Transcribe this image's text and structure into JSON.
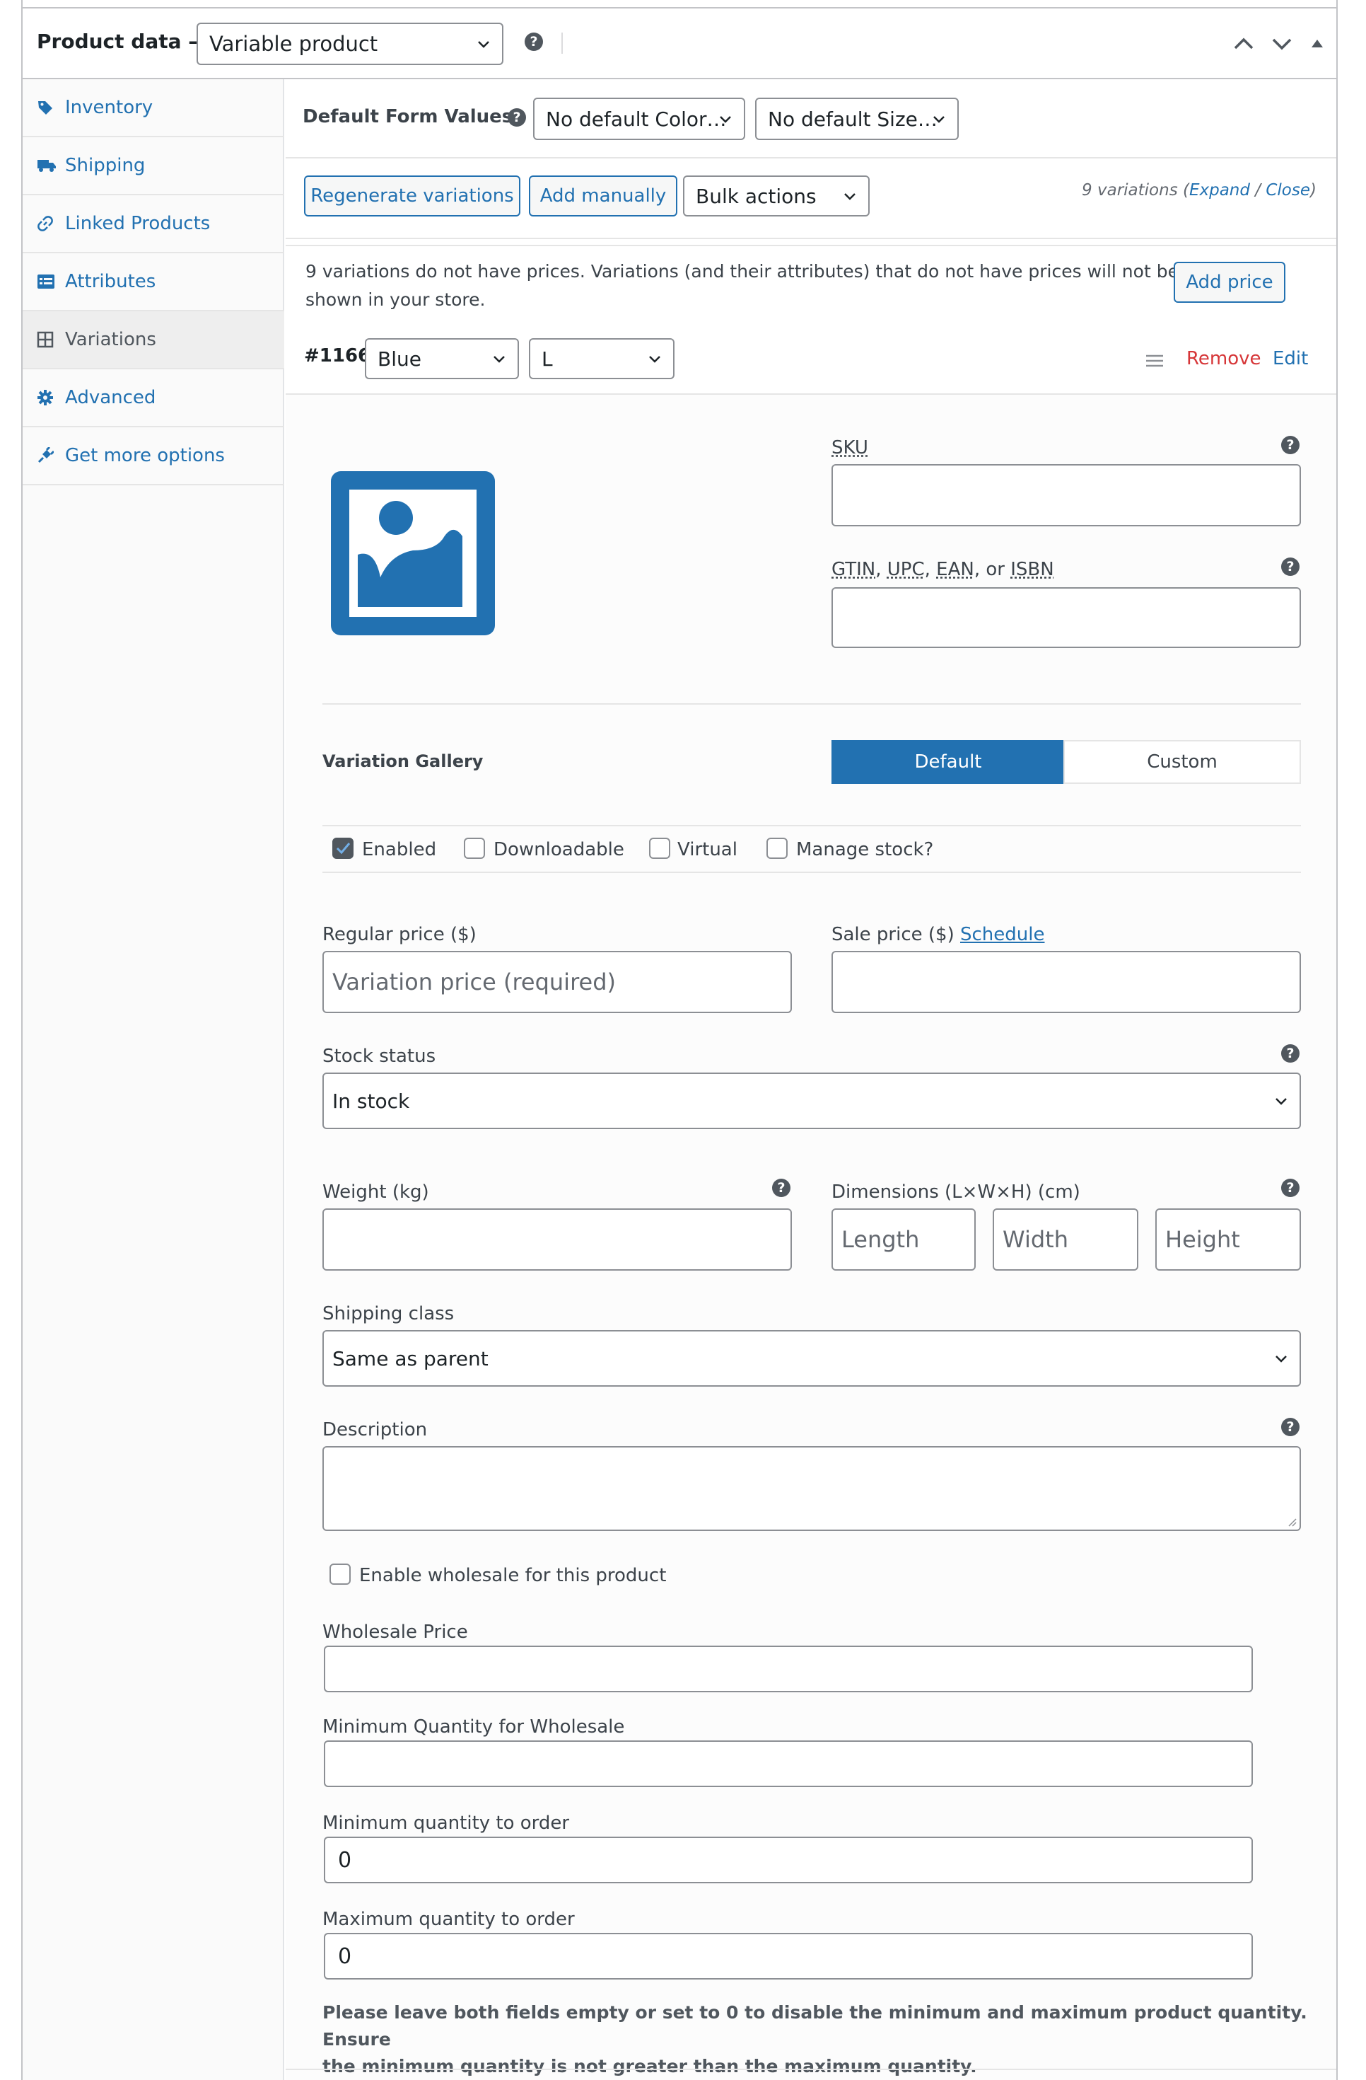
{
  "header": {
    "title": "Product data —",
    "product_type": "Variable product"
  },
  "sidebar": {
    "items": [
      {
        "label": "Inventory",
        "icon": "tag-icon"
      },
      {
        "label": "Shipping",
        "icon": "truck-icon"
      },
      {
        "label": "Linked Products",
        "icon": "link-icon"
      },
      {
        "label": "Attributes",
        "icon": "list-icon"
      },
      {
        "label": "Variations",
        "icon": "grid-icon"
      },
      {
        "label": "Advanced",
        "icon": "gear-icon"
      },
      {
        "label": "Get more options",
        "icon": "plugin-icon"
      }
    ]
  },
  "defaults": {
    "label": "Default Form Values:",
    "color": "No default Color…",
    "size": "No default Size…"
  },
  "toolbar": {
    "regenerate": "Regenerate variations",
    "add_manually": "Add manually",
    "bulk_actions": "Bulk actions",
    "count": "9 variations (",
    "expand": "Expand",
    "slash": " / ",
    "close": "Close",
    "close_paren": ")"
  },
  "notice": {
    "line1": "9 variations do not have prices. Variations (and their attributes) that do not have prices will not be",
    "line2": "shown in your store.",
    "add_price": "Add price"
  },
  "variation": {
    "id": "#1166",
    "color": "Blue",
    "size": "L",
    "remove": "Remove",
    "edit": "Edit",
    "sku_label": "SKU",
    "gtin_label_parts": [
      "GTIN",
      ", ",
      "UPC",
      ", ",
      "EAN",
      ", or ",
      "ISBN"
    ],
    "gallery_label": "Variation Gallery",
    "gallery_default": "Default",
    "gallery_custom": "Custom",
    "enabled": "Enabled",
    "downloadable": "Downloadable",
    "virtual": "Virtual",
    "manage_stock": "Manage stock?",
    "regular_price_label": "Regular price ($)",
    "regular_price_placeholder": "Variation price (required)",
    "sale_price_label": "Sale price ($)",
    "schedule": "Schedule",
    "stock_status_label": "Stock status",
    "stock_status": "In stock",
    "weight_label": "Weight (kg)",
    "dimensions_label": "Dimensions (L×W×H) (cm)",
    "length_ph": "Length",
    "width_ph": "Width",
    "height_ph": "Height",
    "shipping_class_label": "Shipping class",
    "shipping_class": "Same as parent",
    "description_label": "Description",
    "wholesale_enable": "Enable wholesale for this product",
    "wholesale_price_label": "Wholesale Price",
    "min_wholesale_label": "Minimum Quantity for Wholesale",
    "min_order_label": "Minimum quantity to order",
    "min_order_value": "0",
    "max_order_label": "Maximum quantity to order",
    "max_order_value": "0",
    "note_line1": "Please leave both fields empty or set to 0 to disable the minimum and maximum product quantity. Ensure",
    "note_line2": "the minimum quantity is not greater than the maximum quantity."
  },
  "colors": {
    "accent": "#2271b1",
    "danger": "#d63638",
    "text": "#1d2327"
  }
}
